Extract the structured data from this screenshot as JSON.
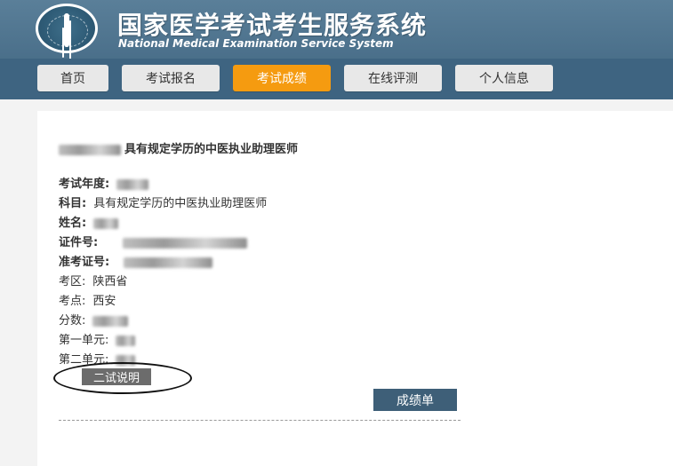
{
  "header": {
    "title_cn": "国家医学考试考生服务系统",
    "title_en": "National Medical Examination Service System"
  },
  "nav": {
    "tabs": [
      {
        "label": "首页",
        "active": false
      },
      {
        "label": "考试报名",
        "active": false
      },
      {
        "label": "考试成绩",
        "active": true
      },
      {
        "label": "在线评测",
        "active": false
      },
      {
        "label": "个人信息",
        "active": false
      }
    ]
  },
  "result": {
    "subject_title": "具有规定学历的中医执业助理医师",
    "fields": [
      {
        "label": "考试年度:",
        "value": ""
      },
      {
        "label": "科目:",
        "value": "具有规定学历的中医执业助理医师"
      },
      {
        "label": "姓名:",
        "value": ""
      },
      {
        "label": "证件号:",
        "value": ""
      },
      {
        "label": "准考证号:",
        "value": ""
      },
      {
        "label": "考区:",
        "value": "陕西省"
      },
      {
        "label": "考点:",
        "value": "西安"
      },
      {
        "label": "分数:",
        "value": ""
      },
      {
        "label": "第一单元:",
        "value": ""
      },
      {
        "label": "第二单元:",
        "value": ""
      }
    ],
    "explain_button": "二试说明",
    "report_button": "成绩单"
  },
  "colors": {
    "header_bg": "#5a7f99",
    "nav_bg": "#3e6481",
    "active_tab": "#f59b10",
    "report_button": "#3e5f78"
  }
}
